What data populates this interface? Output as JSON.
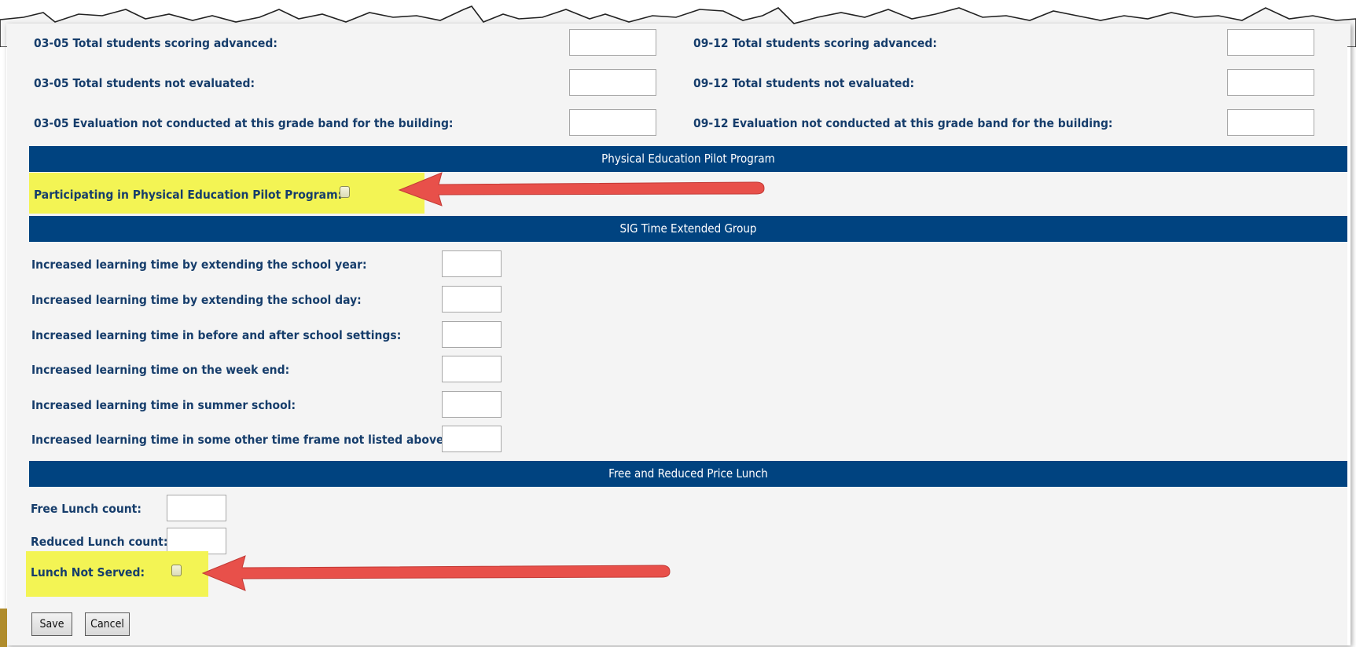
{
  "grade_rows": [
    {
      "left_label": "03-05 Total students scoring advanced:",
      "right_label": "09-12 Total students scoring advanced:",
      "left_value": "",
      "right_value": ""
    },
    {
      "left_label": "03-05 Total students not evaluated:",
      "right_label": "09-12 Total students not evaluated:",
      "left_value": "",
      "right_value": ""
    },
    {
      "left_label": "03-05 Evaluation not conducted at this grade band for the building:",
      "right_label": "09-12 Evaluation not conducted at this grade band for the building:",
      "left_value": "",
      "right_value": ""
    }
  ],
  "pe_section": {
    "title": "Physical Education Pilot Program",
    "participating_label": "Participating in Physical Education Pilot Program:",
    "participating_checked": false
  },
  "sig_section": {
    "title": "SIG Time Extended Group",
    "fields": [
      {
        "label": "Increased learning time by extending the school year:",
        "value": ""
      },
      {
        "label": "Increased learning time by extending the school day:",
        "value": ""
      },
      {
        "label": "Increased learning time in before and after school settings:",
        "value": ""
      },
      {
        "label": "Increased learning time on the week end:",
        "value": ""
      },
      {
        "label": "Increased learning time in summer school:",
        "value": ""
      },
      {
        "label": "Increased learning time in some other time frame not listed above:",
        "value": ""
      }
    ]
  },
  "lunch_section": {
    "title": "Free and Reduced Price Lunch",
    "free_label": "Free Lunch count:",
    "free_value": "",
    "reduced_label": "Reduced Lunch count:",
    "reduced_value": "",
    "not_served_label": "Lunch Not Served:",
    "not_served_checked": false
  },
  "buttons": {
    "save": "Save",
    "cancel": "Cancel"
  },
  "colors": {
    "section_bar": "#004380",
    "label_text": "#163d6b",
    "highlight": "#f3f454",
    "arrow": "#e8504a",
    "background": "#f4f4f4"
  },
  "icons": {
    "arrow_1": "red-arrow-left",
    "arrow_2": "red-arrow-left"
  }
}
